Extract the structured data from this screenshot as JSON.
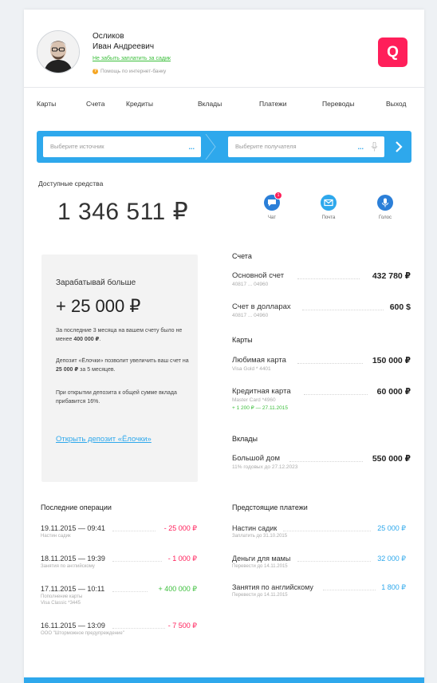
{
  "user": {
    "last_name": "Осликов",
    "first_name": "Иван Андреевич",
    "reminder_link": "Не забыть заплатить за садик",
    "help_text": "Помощь по интернет-банку"
  },
  "brand": {
    "logo_letter": "Q",
    "accent": "#ff1f5a",
    "primary": "#2ea8ec"
  },
  "nav": {
    "items": [
      "Карты",
      "Счета",
      "Кредиты",
      "Вклады",
      "Платежи",
      "Переводы",
      "Выход"
    ]
  },
  "transfer": {
    "source_placeholder": "Выберите источник",
    "target_placeholder": "Выберите получателя",
    "more": "..."
  },
  "balance": {
    "label": "Доступные средства",
    "amount": "1 346 511 ₽"
  },
  "quick_actions": [
    {
      "label": "Чат",
      "icon": "chat-icon",
      "badge": "1"
    },
    {
      "label": "Почта",
      "icon": "mail-icon"
    },
    {
      "label": "Голос",
      "icon": "microphone-icon"
    }
  ],
  "promo": {
    "title": "Зарабатывай больше",
    "amount": "+ 25 000 ₽",
    "p1_a": "За последние 3 месяца на вашем счету было не менее ",
    "p1_b": "400 000 ₽",
    "p1_c": ".",
    "p2_a": "Депозит «Ёлочки» позволит увеличить ваш счет на ",
    "p2_b": "25 000 ₽",
    "p2_c": " за 5 месяцев.",
    "p3": "При открытии депозита к общей сумме вклада прибавится 16%.",
    "link": "Открыть депозит «Ёлочки»"
  },
  "accounts": {
    "title": "Счета",
    "items": [
      {
        "name": "Основной счет",
        "sub": "40817 ... 04960",
        "amount": "432 780 ₽"
      },
      {
        "name": "Счет в долларах",
        "sub": "40817 ... 04960",
        "amount": "600 $"
      }
    ]
  },
  "cards": {
    "title": "Карты",
    "items": [
      {
        "name": "Любимая карта",
        "sub": "Visa Gold * 4401",
        "amount": "150 000 ₽"
      },
      {
        "name": "Кредитная карта",
        "sub": "Master Card *4960",
        "sub2": "+ 1 200 ₽ — 27.11.2015",
        "amount": "60 000 ₽"
      }
    ]
  },
  "deposits": {
    "title": "Вклады",
    "items": [
      {
        "name": "Большой дом",
        "sub": "11% годовых до 27.12.2023",
        "amount": "550 000 ₽"
      }
    ]
  },
  "operations": {
    "title": "Последние операции",
    "items": [
      {
        "date": "19.11.2015 — 09:41",
        "sub": "Настин садик",
        "amount": "- 25 000 ₽"
      },
      {
        "date": "18.11.2015 — 19:39",
        "sub": "Занятия по английскому",
        "amount": "- 1 000 ₽"
      },
      {
        "date": "17.11.2015 — 10:11",
        "sub": "Пополнение карты",
        "sub2": "Visa Classic *3445",
        "amount": "+ 400 000 ₽"
      },
      {
        "date": "16.11.2015 — 13:09",
        "sub": "ООО \"Шторможное предупреждение\"",
        "amount": "- 7 500 ₽"
      }
    ]
  },
  "upcoming": {
    "title": "Предстоящие платежи",
    "items": [
      {
        "name": "Настин садик",
        "sub": "Заплатить до 31.10.2015",
        "amount": "25 000 ₽"
      },
      {
        "name": "Деньги для мамы",
        "sub": "Перевести до 14.11.2015",
        "amount": "32 000 ₽"
      },
      {
        "name": "Занятия по английскому",
        "sub": "Перевести до 14.11.2015",
        "amount": "1 800 ₽"
      }
    ]
  }
}
